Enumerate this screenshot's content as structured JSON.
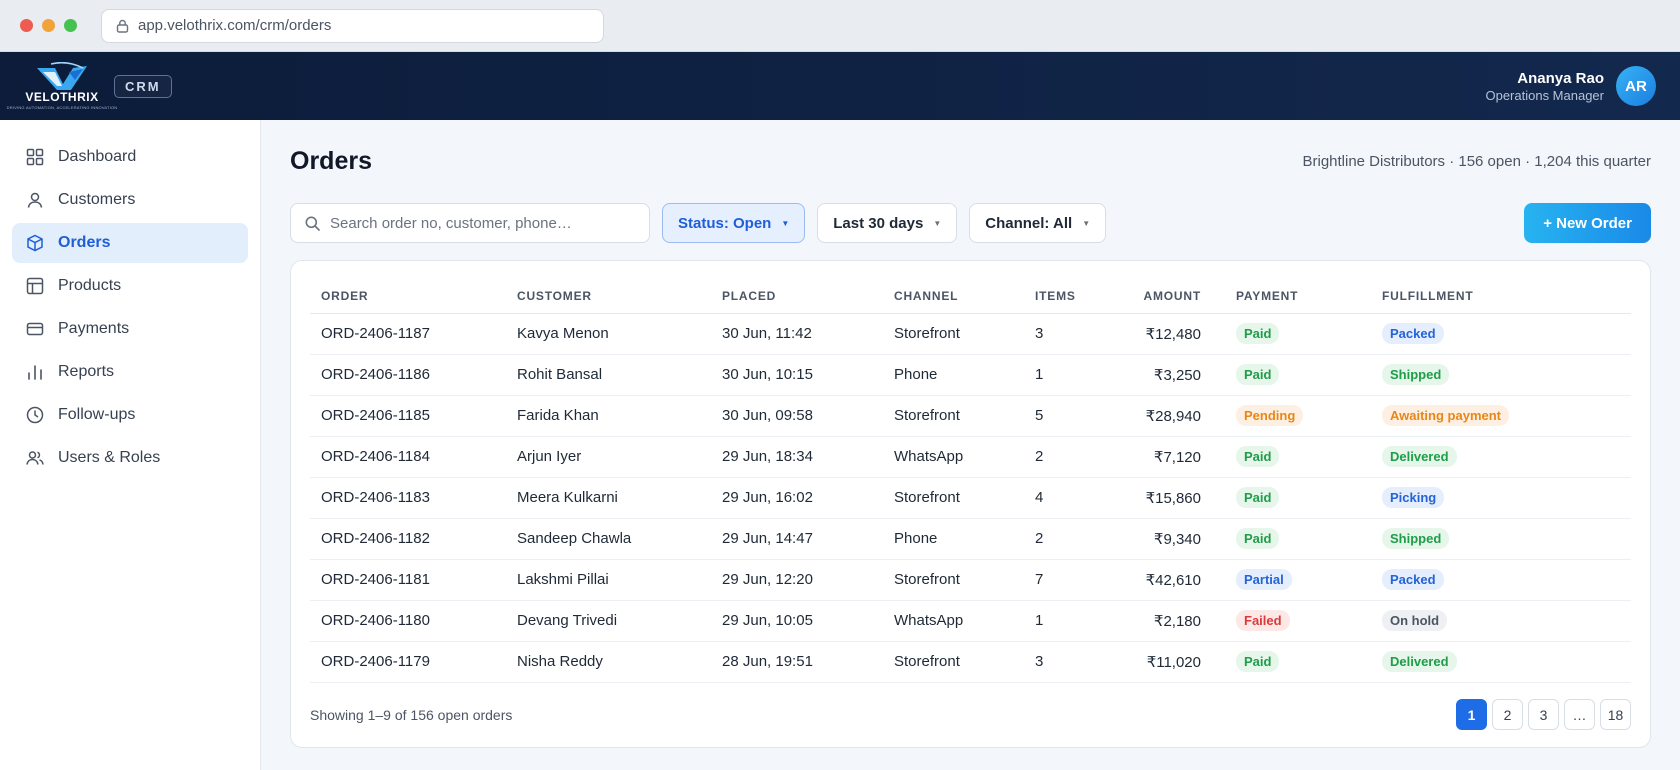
{
  "browser": {
    "url": "app.velothrix.com/crm/orders",
    "dot_colors": [
      "#ee5b52",
      "#f1a33a",
      "#45c14f"
    ]
  },
  "header": {
    "brand": "VELOTHRIX",
    "brand_tagline": "DRIVING AUTOMATION, ACCELERATING INNOVATION",
    "product_badge": "CRM",
    "user_name": "Ananya Rao",
    "user_role": "Operations Manager",
    "user_initials": "AR"
  },
  "sidebar": {
    "items": [
      {
        "label": "Dashboard",
        "icon": "dashboard-grid-icon"
      },
      {
        "label": "Customers",
        "icon": "user-icon"
      },
      {
        "label": "Orders",
        "icon": "box-icon",
        "active": true
      },
      {
        "label": "Products",
        "icon": "layout-icon"
      },
      {
        "label": "Payments",
        "icon": "card-icon"
      },
      {
        "label": "Reports",
        "icon": "bar-chart-icon"
      },
      {
        "label": "Follow-ups",
        "icon": "clock-icon"
      },
      {
        "label": "Users & Roles",
        "icon": "users-icon"
      }
    ]
  },
  "main": {
    "title": "Orders",
    "summary": "Brightline Distributors · 156 open · 1,204 this quarter",
    "search_placeholder": "Search order no, customer, phone…",
    "filters": {
      "status": "Status: Open",
      "date": "Last 30 days",
      "channel": "Channel: All"
    },
    "new_order_label": "+ New Order"
  },
  "table": {
    "columns": [
      "ORDER",
      "CUSTOMER",
      "PLACED",
      "CHANNEL",
      "ITEMS",
      "AMOUNT",
      "PAYMENT",
      "FULFILLMENT"
    ],
    "rows": [
      {
        "order": "ORD-2406-1187",
        "customer": "Kavya Menon",
        "placed": "30 Jun, 11:42",
        "channel": "Storefront",
        "items": "3",
        "amount": "₹12,480",
        "payment": "Paid",
        "fulfillment": "Packed"
      },
      {
        "order": "ORD-2406-1186",
        "customer": "Rohit Bansal",
        "placed": "30 Jun, 10:15",
        "channel": "Phone",
        "items": "1",
        "amount": "₹3,250",
        "payment": "Paid",
        "fulfillment": "Shipped"
      },
      {
        "order": "ORD-2406-1185",
        "customer": "Farida Khan",
        "placed": "30 Jun, 09:58",
        "channel": "Storefront",
        "items": "5",
        "amount": "₹28,940",
        "payment": "Pending",
        "fulfillment": "Awaiting payment"
      },
      {
        "order": "ORD-2406-1184",
        "customer": "Arjun Iyer",
        "placed": "29 Jun, 18:34",
        "channel": "WhatsApp",
        "items": "2",
        "amount": "₹7,120",
        "payment": "Paid",
        "fulfillment": "Delivered"
      },
      {
        "order": "ORD-2406-1183",
        "customer": "Meera Kulkarni",
        "placed": "29 Jun, 16:02",
        "channel": "Storefront",
        "items": "4",
        "amount": "₹15,860",
        "payment": "Paid",
        "fulfillment": "Picking"
      },
      {
        "order": "ORD-2406-1182",
        "customer": "Sandeep Chawla",
        "placed": "29 Jun, 14:47",
        "channel": "Phone",
        "items": "2",
        "amount": "₹9,340",
        "payment": "Paid",
        "fulfillment": "Shipped"
      },
      {
        "order": "ORD-2406-1181",
        "customer": "Lakshmi Pillai",
        "placed": "29 Jun, 12:20",
        "channel": "Storefront",
        "items": "7",
        "amount": "₹42,610",
        "payment": "Partial",
        "fulfillment": "Packed"
      },
      {
        "order": "ORD-2406-1180",
        "customer": "Devang Trivedi",
        "placed": "29 Jun, 10:05",
        "channel": "WhatsApp",
        "items": "1",
        "amount": "₹2,180",
        "payment": "Failed",
        "fulfillment": "On hold"
      },
      {
        "order": "ORD-2406-1179",
        "customer": "Nisha Reddy",
        "placed": "28 Jun, 19:51",
        "channel": "Storefront",
        "items": "3",
        "amount": "₹11,020",
        "payment": "Paid",
        "fulfillment": "Delivered"
      }
    ]
  },
  "footer": {
    "showing": "Showing 1–9 of 156 open orders",
    "pages": [
      "1",
      "2",
      "3",
      "…",
      "18"
    ],
    "current_page": "1"
  },
  "colors": {
    "accent": "#1e6ce6",
    "header_bg": "#0c1c3a",
    "paid": "#1f9d49",
    "pending": "#e8861a",
    "failed": "#dc3a3a",
    "info": "#2563d6"
  }
}
